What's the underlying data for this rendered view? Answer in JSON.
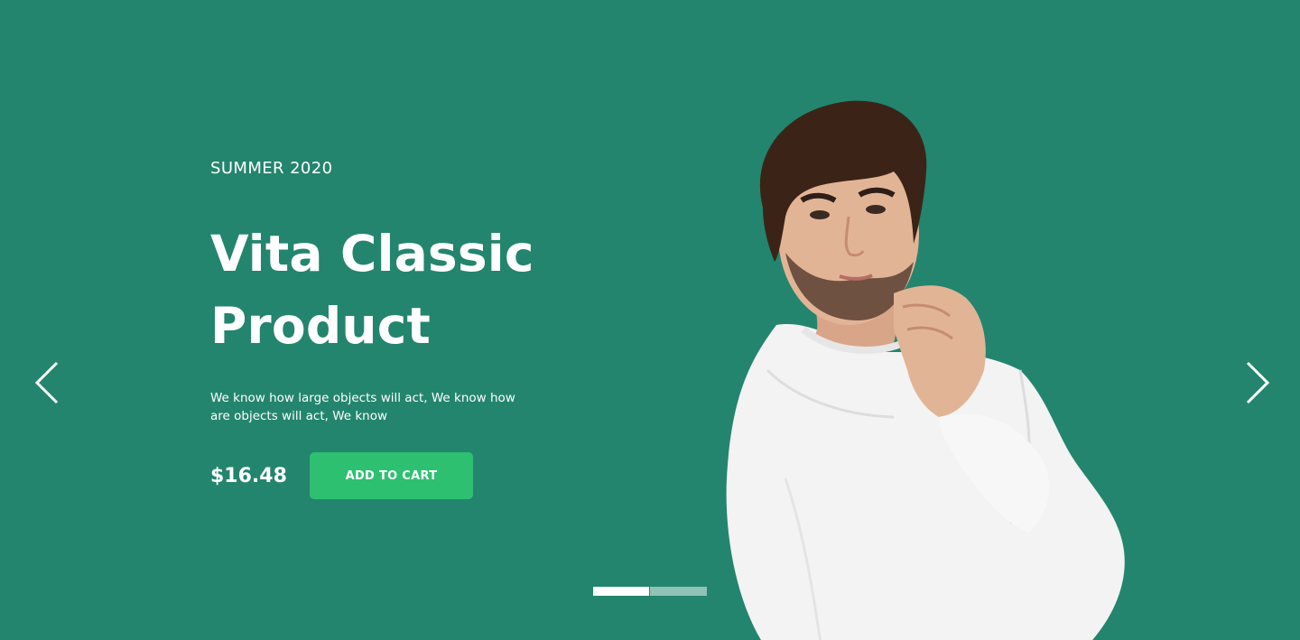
{
  "hero": {
    "season": "SUMMER 2020",
    "title_line1": "Vita Classic",
    "title_line2": "Product",
    "description": "We know how large objects will act, We know how are objects will act, We know",
    "price": "$16.48",
    "cart_label": "ADD TO CART",
    "image_alt": "Man in white sweatshirt"
  },
  "carousel": {
    "slide_count": 2,
    "active_slide": 1,
    "prev_icon": "chevron-left-icon",
    "next_icon": "chevron-right-icon"
  },
  "colors": {
    "background": "#23856D",
    "button": "#2DC071",
    "text": "#FFFFFF"
  }
}
